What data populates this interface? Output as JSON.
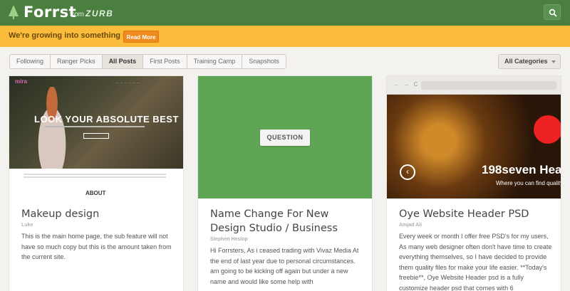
{
  "header": {
    "logo": "Forrst",
    "from": "from",
    "company": "ZURB",
    "search_icon": "search-icon"
  },
  "banner": {
    "text": "We're growing into something new.",
    "button": "Read More"
  },
  "tabs": [
    "Following",
    "Ranger Picks",
    "All Posts",
    "First Posts",
    "Training Camp",
    "Snapshots"
  ],
  "active_tab": "All Posts",
  "category_select": "All Categories",
  "cards": [
    {
      "title": "Makeup design",
      "author": "Luke",
      "body": "This is the main home page, the sub feature will not have so much copy but this is the amount taken from the current site.",
      "thumb": {
        "brand": "mira",
        "headline": "LOOK YOUR ABSOLUTE BEST",
        "about": "ABOUT"
      }
    },
    {
      "title": "Name Change For New Design Studio / Business",
      "author": "Stephen Heslop",
      "body": "Hi Forrsters, As i ceased trading with Vivaz Media At the end of last year due to personal circumstances. am going to be kicking off again but under a new name and would like some help with",
      "thumb": {
        "label": "QUESTION"
      }
    },
    {
      "title": "Oye Website Header PSD",
      "author": "Amjad Ali",
      "body": "Every week or month I offer free PSD's for my users, As many web designer often don't have time to create everything themselves, so I have decided to provide them quality files for make your life easier. **Today's freebie**, Oye Website Header psd is a fully customize header psd that comes with 6",
      "thumb": {
        "nav": "← → C",
        "headline": "198seven Hea",
        "subline": "Where you can find quality"
      }
    }
  ]
}
